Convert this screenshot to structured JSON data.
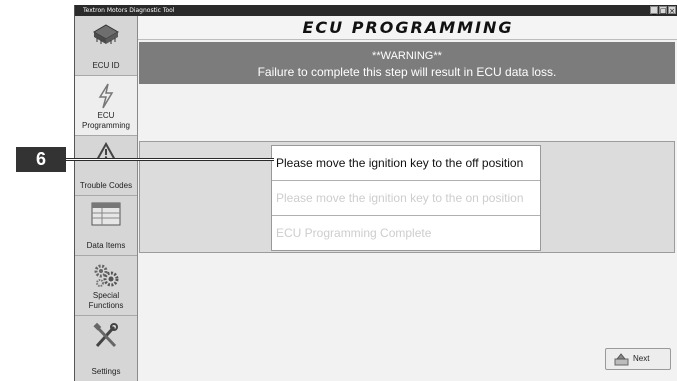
{
  "window": {
    "title": "Textron Motors Diagnostic Tool",
    "controls": [
      "_",
      "□",
      "×"
    ]
  },
  "sidebar": {
    "items": [
      {
        "label": "ECU ID",
        "icon": "chip-icon"
      },
      {
        "label": "ECU Programming",
        "icon": "lightning-icon"
      },
      {
        "label": "Trouble Codes",
        "icon": "warning-triangle-icon"
      },
      {
        "label": "Data Items",
        "icon": "data-table-icon"
      },
      {
        "label": "Special Functions",
        "icon": "gears-icon"
      },
      {
        "label": "Settings",
        "icon": "tools-icon"
      }
    ]
  },
  "main": {
    "heading": "ECU PROGRAMMING",
    "warning": {
      "title": "**WARNING**",
      "message": "Failure to complete this step will result in ECU data loss."
    },
    "steps": [
      {
        "text": "Please move the ignition key to the off position",
        "state": "active"
      },
      {
        "text": "Please move the ignition key to the on position",
        "state": "pending"
      },
      {
        "text": "ECU Programming Complete",
        "state": "pending"
      }
    ],
    "next_button": {
      "label": "Next",
      "icon": "next-arrow-icon"
    }
  },
  "callout": {
    "number": "6"
  },
  "colors": {
    "warning_bg": "#7c7c7c",
    "titlebar_bg": "#2a2a2a",
    "sidebar_bg": "#d6d6d6",
    "pending_text": "#cdcdcd"
  }
}
